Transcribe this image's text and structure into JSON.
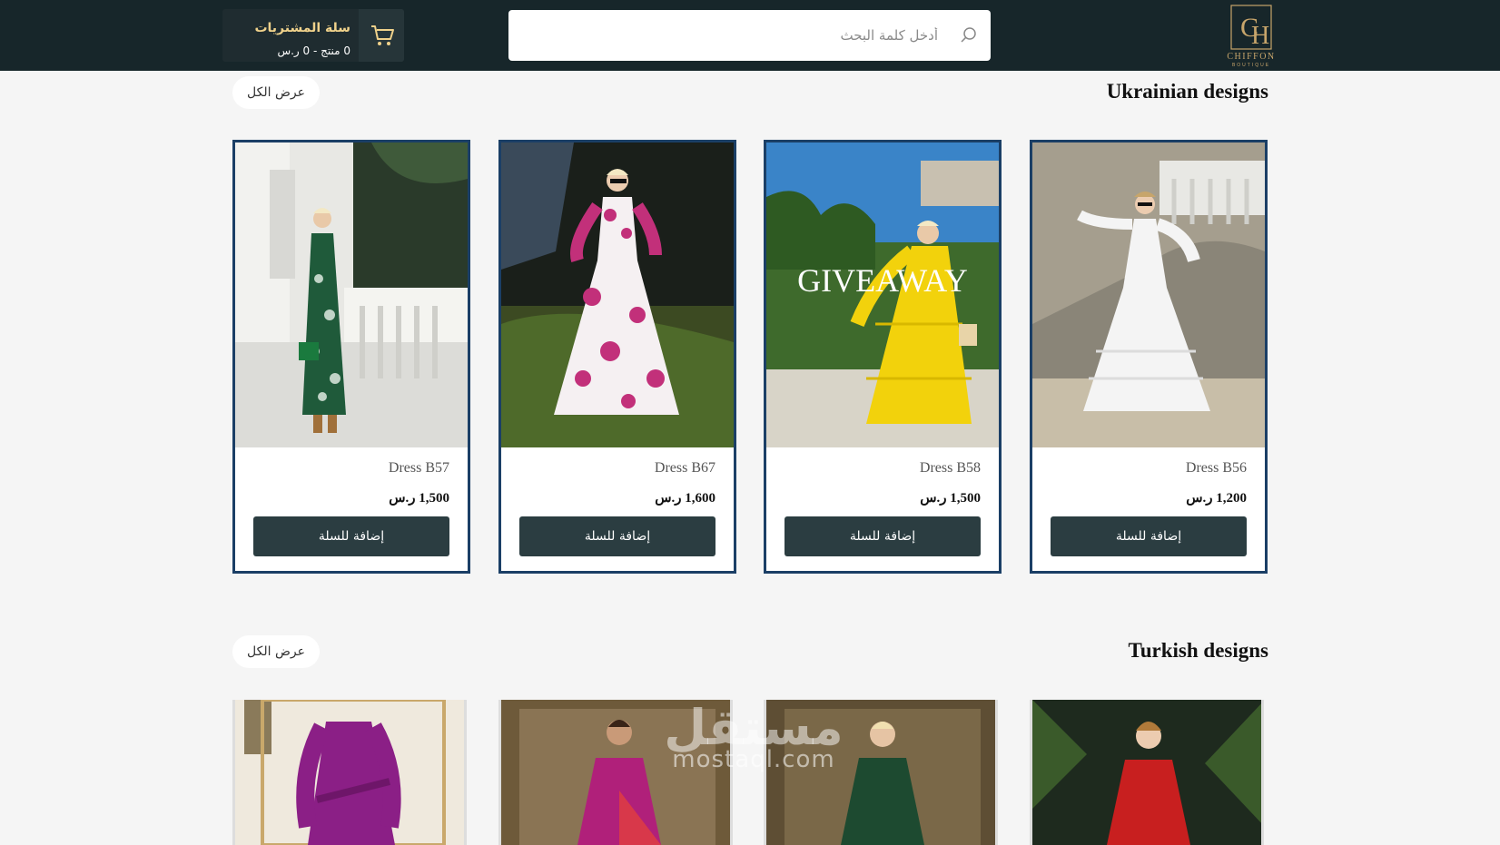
{
  "header": {
    "logo_text": "CHIFFON",
    "logo_sub": "BOUTIQUE",
    "search_placeholder": "أدخل كلمة البحث",
    "cart_title": "سلة المشتريات",
    "cart_summary": "0 منتج - 0 ر.س"
  },
  "sections": [
    {
      "title": "Ukrainian designs",
      "view_all": "عرض الكل",
      "products": [
        {
          "name": "Dress B57",
          "price": "1,500 ر.س",
          "button": "إضافة للسلة",
          "dress_color": "#1f5a3a"
        },
        {
          "name": "Dress B67",
          "price": "1,600 ر.س",
          "button": "إضافة للسلة",
          "dress_color": "#c2307a"
        },
        {
          "name": "Dress B58",
          "price": "1,500 ر.س",
          "button": "إضافة للسلة",
          "dress_color": "#f2d20c",
          "overlay_text": "GIVEAWAY"
        },
        {
          "name": "Dress B56",
          "price": "1,200 ر.س",
          "button": "إضافة للسلة",
          "dress_color": "#f4f4f4"
        }
      ]
    },
    {
      "title": "Turkish designs",
      "view_all": "عرض الكل",
      "products": [
        {
          "dress_color": "#8b1f86"
        },
        {
          "dress_color": "#b0207a"
        },
        {
          "dress_color": "#1d4a30"
        },
        {
          "dress_color": "#c81f1f"
        }
      ]
    }
  ],
  "watermark": {
    "arabic": "مستقل",
    "latin": "mostaql.com"
  },
  "colors": {
    "header_bg": "#17262a",
    "accent_gold": "#c7a56b",
    "button_bg": "#2b3d41",
    "card_border": "#1b3f66"
  }
}
